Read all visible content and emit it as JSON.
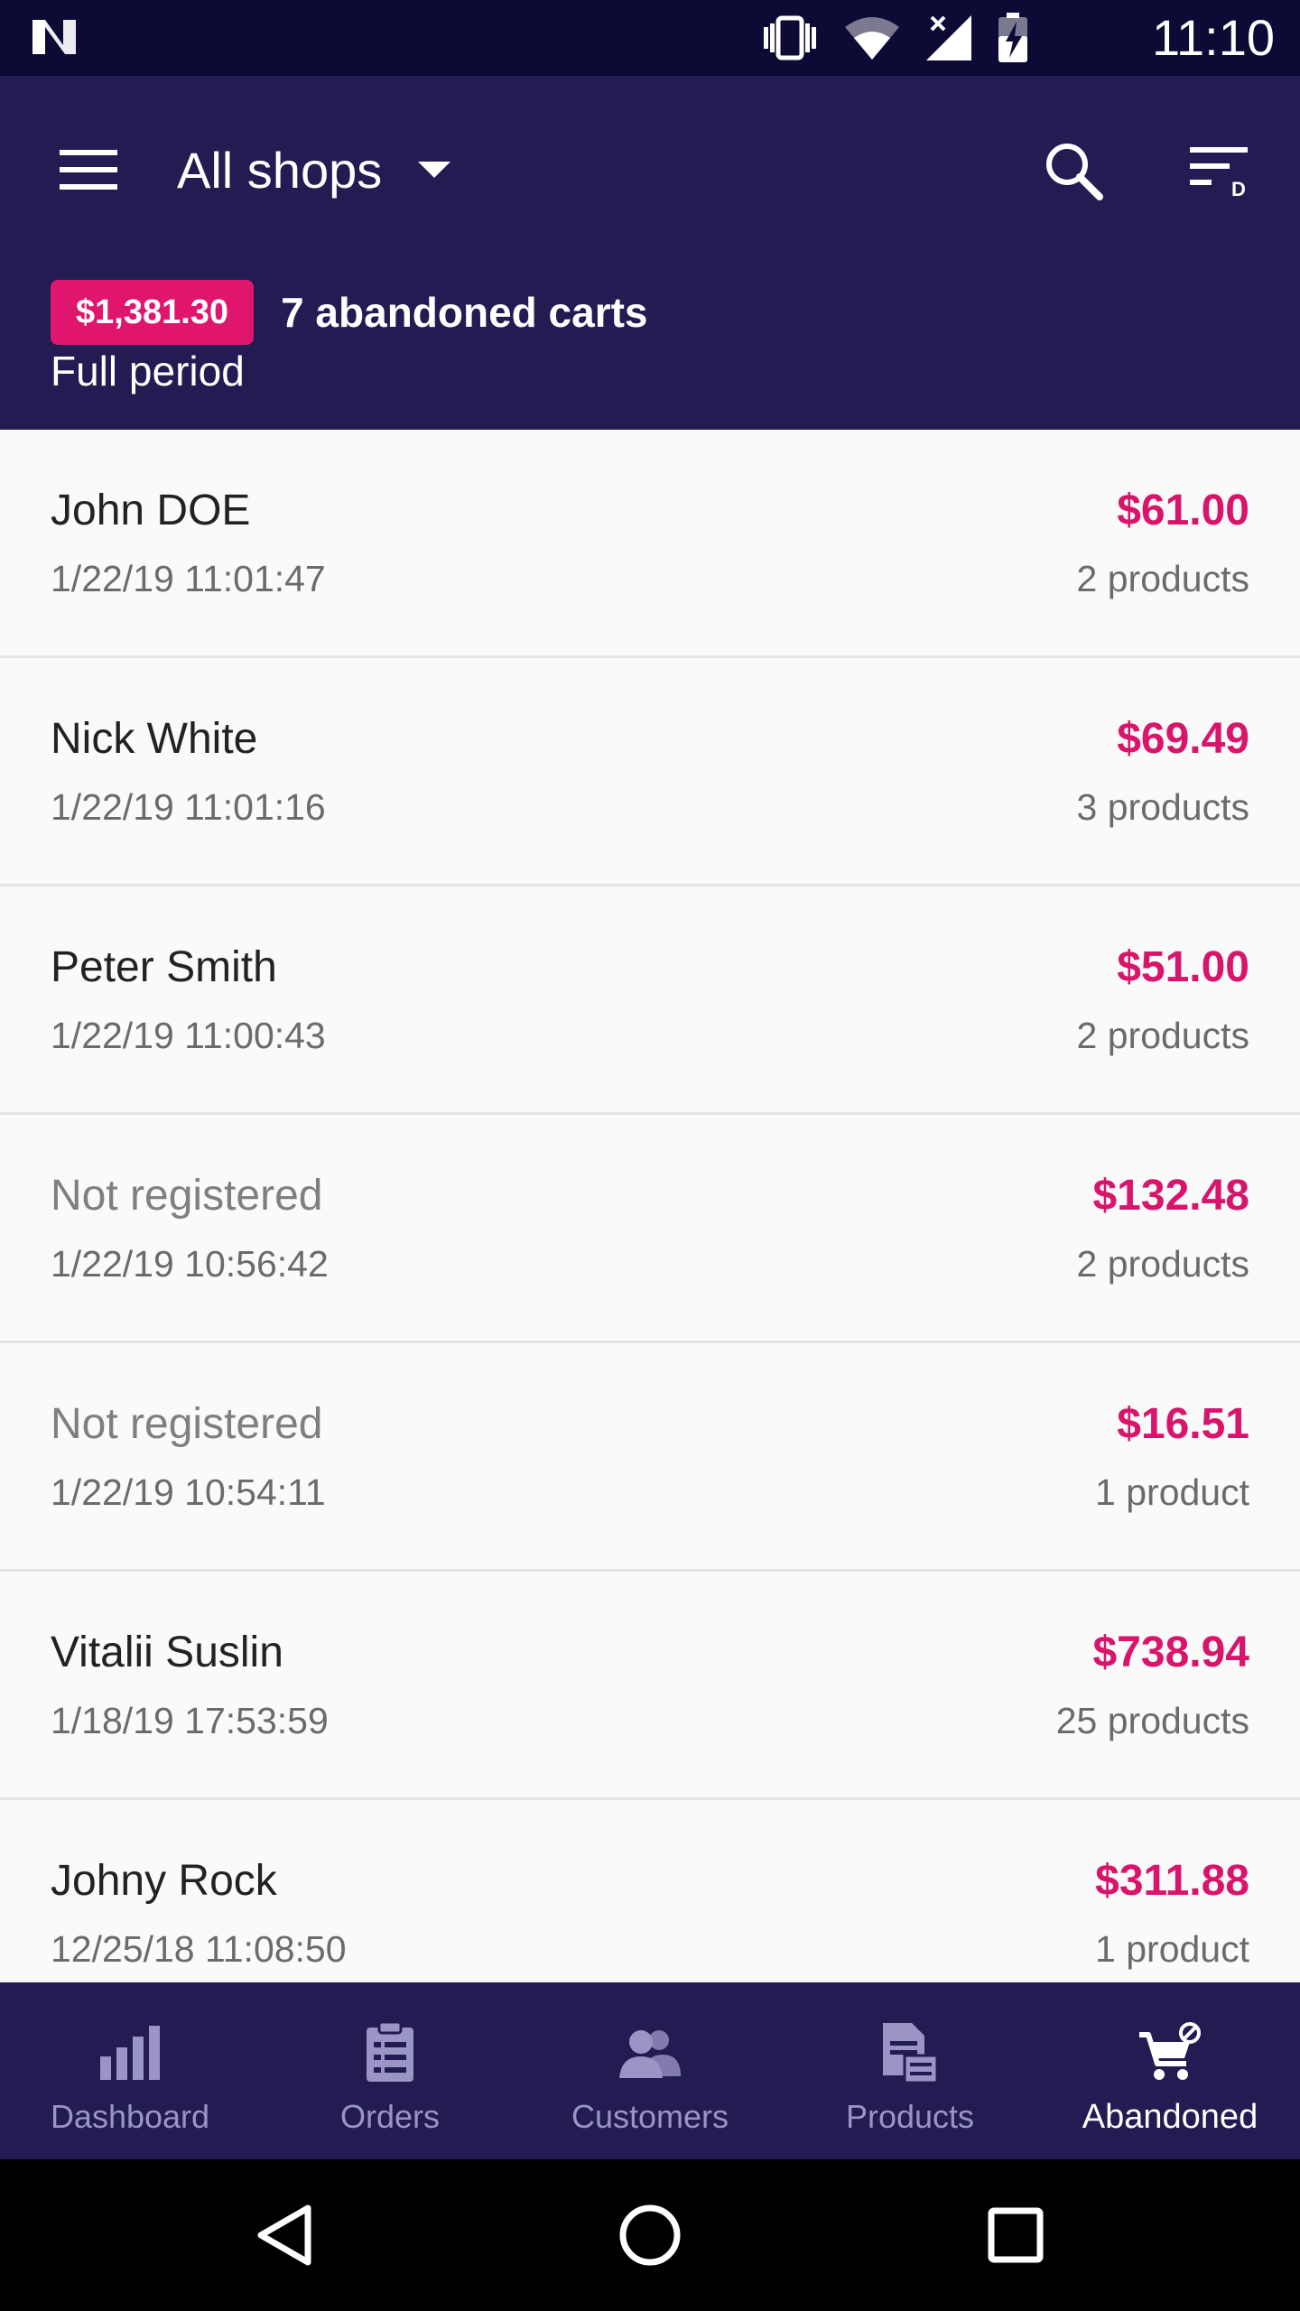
{
  "status_bar": {
    "time": "11:10",
    "icons": [
      "n-logo-icon",
      "vibrate-icon",
      "wifi-icon",
      "signal-icon",
      "battery-icon"
    ]
  },
  "app_bar": {
    "shop_selector": "All shops",
    "icons": [
      "menu-icon",
      "search-icon",
      "sort-filter-icon"
    ]
  },
  "summary": {
    "amount": "$1,381.30",
    "count_label": "7 abandoned carts",
    "period": "Full period"
  },
  "carts": [
    {
      "name": "John DOE",
      "date": "1/22/19 11:01:47",
      "total": "$61.00",
      "products": "2 products",
      "registered": true
    },
    {
      "name": "Nick White",
      "date": "1/22/19 11:01:16",
      "total": "$69.49",
      "products": "3 products",
      "registered": true
    },
    {
      "name": "Peter Smith",
      "date": "1/22/19 11:00:43",
      "total": "$51.00",
      "products": "2 products",
      "registered": true
    },
    {
      "name": "Not registered",
      "date": "1/22/19 10:56:42",
      "total": "$132.48",
      "products": "2 products",
      "registered": false
    },
    {
      "name": "Not registered",
      "date": "1/22/19 10:54:11",
      "total": "$16.51",
      "products": "1 product",
      "registered": false
    },
    {
      "name": "Vitalii Suslin",
      "date": "1/18/19 17:53:59",
      "total": "$738.94",
      "products": "25 products",
      "registered": true
    },
    {
      "name": "Johny Rock",
      "date": "12/25/18 11:08:50",
      "total": "$311.88",
      "products": "1 product",
      "registered": true
    }
  ],
  "bottom_nav": {
    "items": [
      {
        "label": "Dashboard",
        "icon": "bar-chart-icon"
      },
      {
        "label": "Orders",
        "icon": "clipboard-icon"
      },
      {
        "label": "Customers",
        "icon": "people-icon"
      },
      {
        "label": "Products",
        "icon": "document-icon"
      },
      {
        "label": "Abandoned",
        "icon": "cart-icon"
      }
    ],
    "active": "Abandoned"
  },
  "system_nav": [
    "back-icon",
    "home-icon",
    "recents-icon"
  ],
  "colors": {
    "status_bar": "#0d0b36",
    "app_bar": "#221c52",
    "accent": "#e0156e",
    "price": "#d8146b",
    "nav_inactive": "#9a95c4"
  }
}
